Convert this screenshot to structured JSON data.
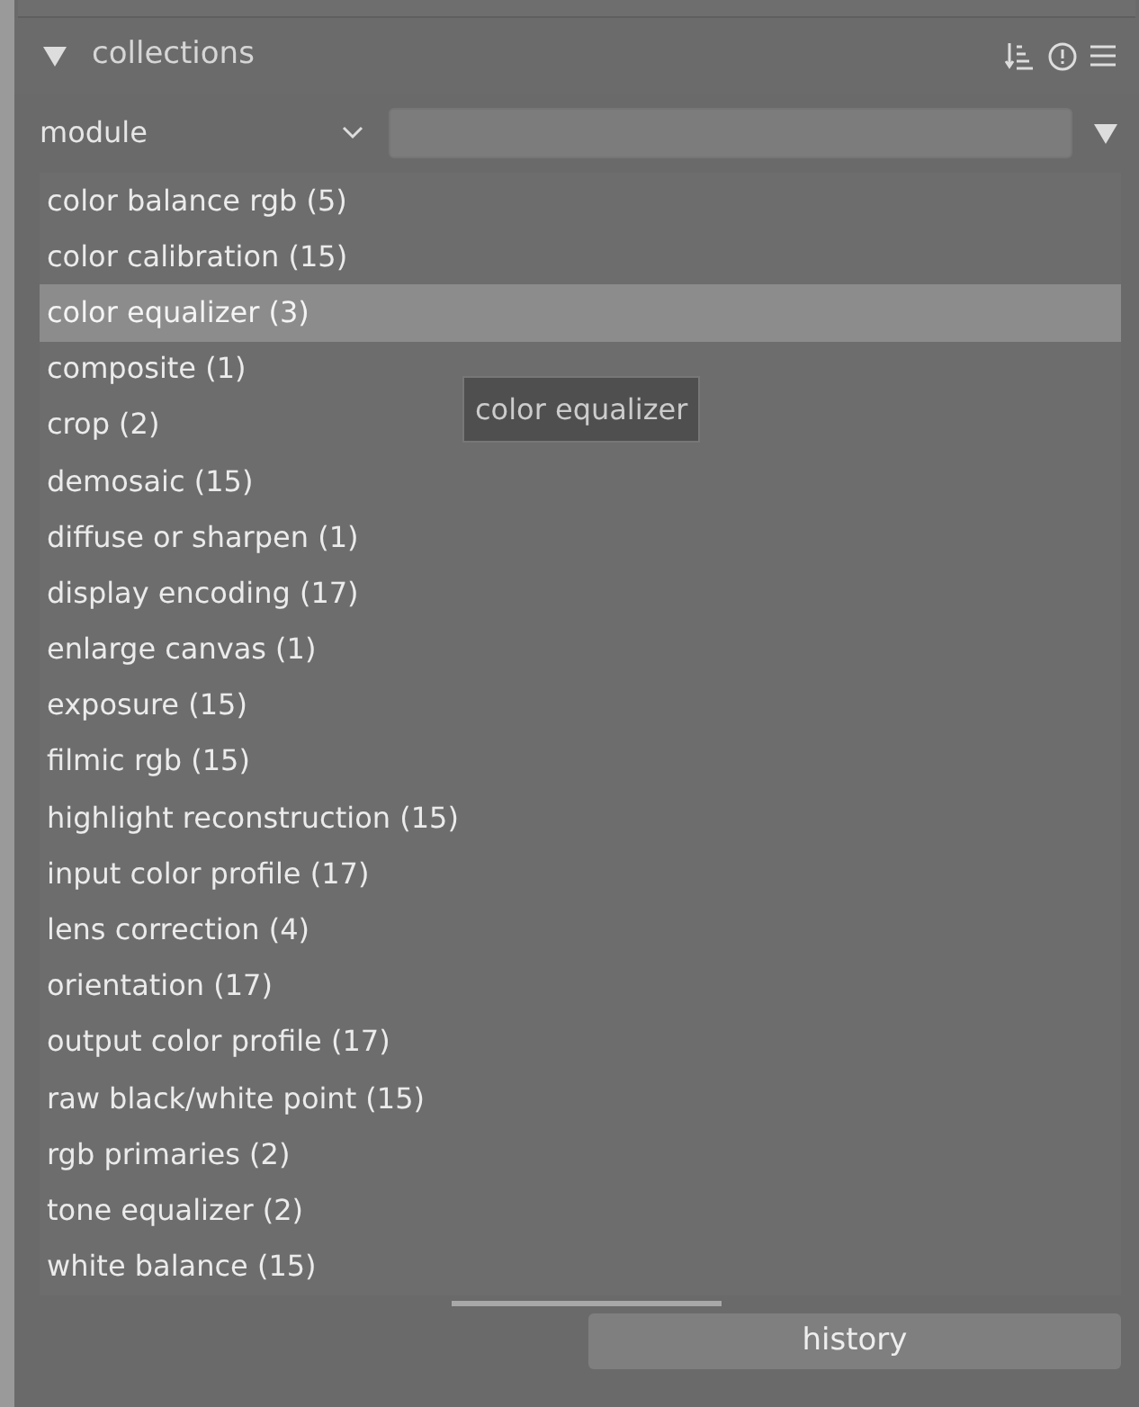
{
  "header": {
    "expanded": true,
    "title": "collections"
  },
  "filter": {
    "property": "module"
  },
  "items": [
    {
      "label": "color balance rgb (5)",
      "selected": false
    },
    {
      "label": "color calibration (15)",
      "selected": false
    },
    {
      "label": "color equalizer (3)",
      "selected": true
    },
    {
      "label": "composite (1)",
      "selected": false
    },
    {
      "label": "crop (2)",
      "selected": false
    },
    {
      "label": "demosaic (15)",
      "selected": false
    },
    {
      "label": "diffuse or sharpen (1)",
      "selected": false
    },
    {
      "label": "display encoding (17)",
      "selected": false
    },
    {
      "label": "enlarge canvas (1)",
      "selected": false
    },
    {
      "label": "exposure (15)",
      "selected": false
    },
    {
      "label": "filmic rgb (15)",
      "selected": false
    },
    {
      "label": "highlight reconstruction (15)",
      "selected": false
    },
    {
      "label": "input color profile (17)",
      "selected": false
    },
    {
      "label": "lens correction (4)",
      "selected": false
    },
    {
      "label": "orientation (17)",
      "selected": false
    },
    {
      "label": "output color profile (17)",
      "selected": false
    },
    {
      "label": "raw black/white point (15)",
      "selected": false
    },
    {
      "label": "rgb primaries (2)",
      "selected": false
    },
    {
      "label": "tone equalizer (2)",
      "selected": false
    },
    {
      "label": "white balance (15)",
      "selected": false
    }
  ],
  "tooltip": "color equalizer",
  "history_button": "history"
}
